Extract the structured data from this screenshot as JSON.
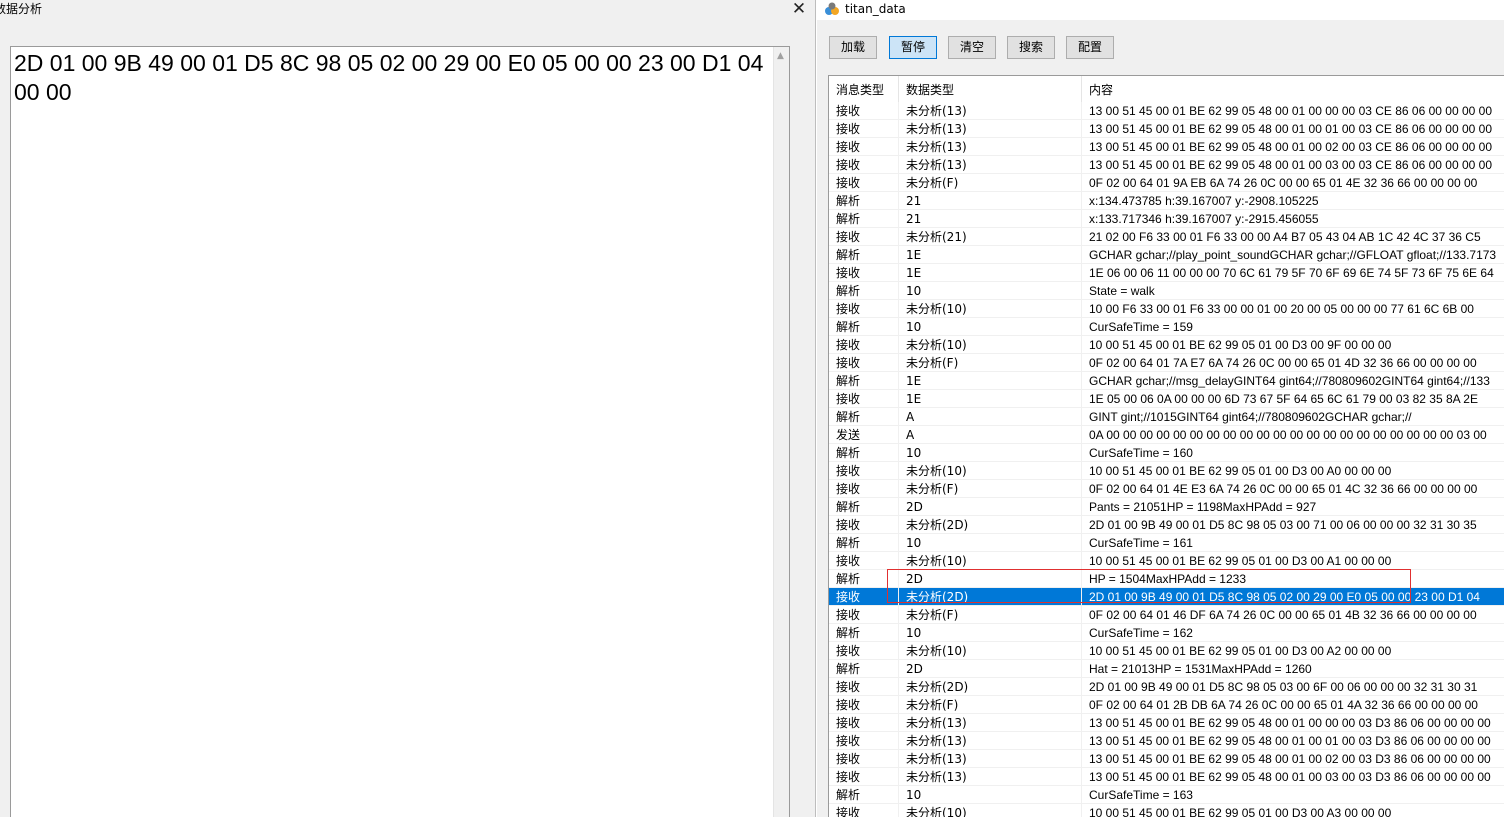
{
  "left": {
    "title": "数据分析",
    "close_glyph": "✕",
    "text": "2D 01 00 9B 49 00 01 D5 8C 98 05 02 00 29 00 E0 05 00 00 23 00 D1 04 00 00",
    "scroll_up_glyph": "▲"
  },
  "right": {
    "title": "titan_data",
    "buttons": [
      "加载",
      "暂停",
      "清空",
      "搜索",
      "配置"
    ],
    "active_button": "暂停",
    "columns": [
      "消息类型",
      "数据类型",
      "内容"
    ],
    "rows": [
      [
        "接收",
        "未分析(13)",
        "13 00 51 45 00 01 BE 62 99 05 48 00 01 00 00 00 03 CE 86 06 00 00 00 00"
      ],
      [
        "接收",
        "未分析(13)",
        "13 00 51 45 00 01 BE 62 99 05 48 00 01 00 01 00 03 CE 86 06 00 00 00 00"
      ],
      [
        "接收",
        "未分析(13)",
        "13 00 51 45 00 01 BE 62 99 05 48 00 01 00 02 00 03 CE 86 06 00 00 00 00"
      ],
      [
        "接收",
        "未分析(13)",
        "13 00 51 45 00 01 BE 62 99 05 48 00 01 00 03 00 03 CE 86 06 00 00 00 00"
      ],
      [
        "接收",
        "未分析(F)",
        "0F 02 00 64 01 9A EB 6A 74 26 0C 00 00 65 01 4E 32 36 66 00 00 00 00"
      ],
      [
        "解析",
        "21",
        "x:134.473785 h:39.167007 y:-2908.105225"
      ],
      [
        "解析",
        "21",
        "x:133.717346 h:39.167007 y:-2915.456055"
      ],
      [
        "接收",
        "未分析(21)",
        "21 02 00 F6 33 00 01 F6 33 00 00 A4 B7 05 43 04 AB 1C 42 4C 37 36 C5"
      ],
      [
        "解析",
        "1E",
        "GCHAR gchar;//play_point_soundGCHAR gchar;//GFLOAT gfloat;//133.7173"
      ],
      [
        "接收",
        "1E",
        "1E 06 00 06 11 00 00 00 70 6C 61 79 5F 70 6F 69 6E 74 5F 73 6F 75 6E 64"
      ],
      [
        "解析",
        "10",
        "State = walk"
      ],
      [
        "接收",
        "未分析(10)",
        "10 00 F6 33 00 01 F6 33 00 00 01 00 20 00 05 00 00 00 77 61 6C 6B 00"
      ],
      [
        "解析",
        "10",
        "CurSafeTime = 159"
      ],
      [
        "接收",
        "未分析(10)",
        "10 00 51 45 00 01 BE 62 99 05 01 00 D3 00 9F 00 00 00"
      ],
      [
        "接收",
        "未分析(F)",
        "0F 02 00 64 01 7A E7 6A 74 26 0C 00 00 65 01 4D 32 36 66 00 00 00 00"
      ],
      [
        "解析",
        "1E",
        "GCHAR gchar;//msg_delayGINT64 gint64;//780809602GINT64 gint64;//133"
      ],
      [
        "接收",
        "1E",
        "1E 05 00 06 0A 00 00 00 6D 73 67 5F 64 65 6C 61 79 00 03 82 35 8A 2E"
      ],
      [
        "解析",
        "A",
        "GINT gint;//1015GINT64 gint64;//780809602GCHAR gchar;//"
      ],
      [
        "发送",
        "A",
        "0A 00 00 00 00 00 00 00 00 00 00 00 00 00 00 00 00 00 00 00 00 00 03 00"
      ],
      [
        "解析",
        "10",
        "CurSafeTime = 160"
      ],
      [
        "接收",
        "未分析(10)",
        "10 00 51 45 00 01 BE 62 99 05 01 00 D3 00 A0 00 00 00"
      ],
      [
        "接收",
        "未分析(F)",
        "0F 02 00 64 01 4E E3 6A 74 26 0C 00 00 65 01 4C 32 36 66 00 00 00 00"
      ],
      [
        "解析",
        "2D",
        "Pants = 21051HP = 1198MaxHPAdd = 927"
      ],
      [
        "接收",
        "未分析(2D)",
        "2D 01 00 9B 49 00 01 D5 8C 98 05 03 00 71 00 06 00 00 00 32 31 30 35"
      ],
      [
        "解析",
        "10",
        "CurSafeTime = 161"
      ],
      [
        "接收",
        "未分析(10)",
        "10 00 51 45 00 01 BE 62 99 05 01 00 D3 00 A1 00 00 00"
      ],
      [
        "解析",
        "2D",
        "HP = 1504MaxHPAdd = 1233"
      ],
      [
        "接收",
        "未分析(2D)",
        "2D 01 00 9B 49 00 01 D5 8C 98 05 02 00 29 00 E0 05 00 00 23 00 D1 04"
      ],
      [
        "接收",
        "未分析(F)",
        "0F 02 00 64 01 46 DF 6A 74 26 0C 00 00 65 01 4B 32 36 66 00 00 00 00"
      ],
      [
        "解析",
        "10",
        "CurSafeTime = 162"
      ],
      [
        "接收",
        "未分析(10)",
        "10 00 51 45 00 01 BE 62 99 05 01 00 D3 00 A2 00 00 00"
      ],
      [
        "解析",
        "2D",
        "Hat = 21013HP = 1531MaxHPAdd = 1260"
      ],
      [
        "接收",
        "未分析(2D)",
        "2D 01 00 9B 49 00 01 D5 8C 98 05 03 00 6F 00 06 00 00 00 32 31 30 31"
      ],
      [
        "接收",
        "未分析(F)",
        "0F 02 00 64 01 2B DB 6A 74 26 0C 00 00 65 01 4A 32 36 66 00 00 00 00"
      ],
      [
        "接收",
        "未分析(13)",
        "13 00 51 45 00 01 BE 62 99 05 48 00 01 00 00 00 03 D3 86 06 00 00 00 00"
      ],
      [
        "接收",
        "未分析(13)",
        "13 00 51 45 00 01 BE 62 99 05 48 00 01 00 01 00 03 D3 86 06 00 00 00 00"
      ],
      [
        "接收",
        "未分析(13)",
        "13 00 51 45 00 01 BE 62 99 05 48 00 01 00 02 00 03 D3 86 06 00 00 00 00"
      ],
      [
        "接收",
        "未分析(13)",
        "13 00 51 45 00 01 BE 62 99 05 48 00 01 00 03 00 03 D3 86 06 00 00 00 00"
      ],
      [
        "解析",
        "10",
        "CurSafeTime = 163"
      ],
      [
        "接收",
        "未分析(10)",
        "10 00 51 45 00 01 BE 62 99 05 01 00 D3 00 A3 00 00 00"
      ]
    ],
    "selected_row": 27,
    "colors": {
      "selection": "#0078d7",
      "highlight_box": "#e03030"
    }
  }
}
